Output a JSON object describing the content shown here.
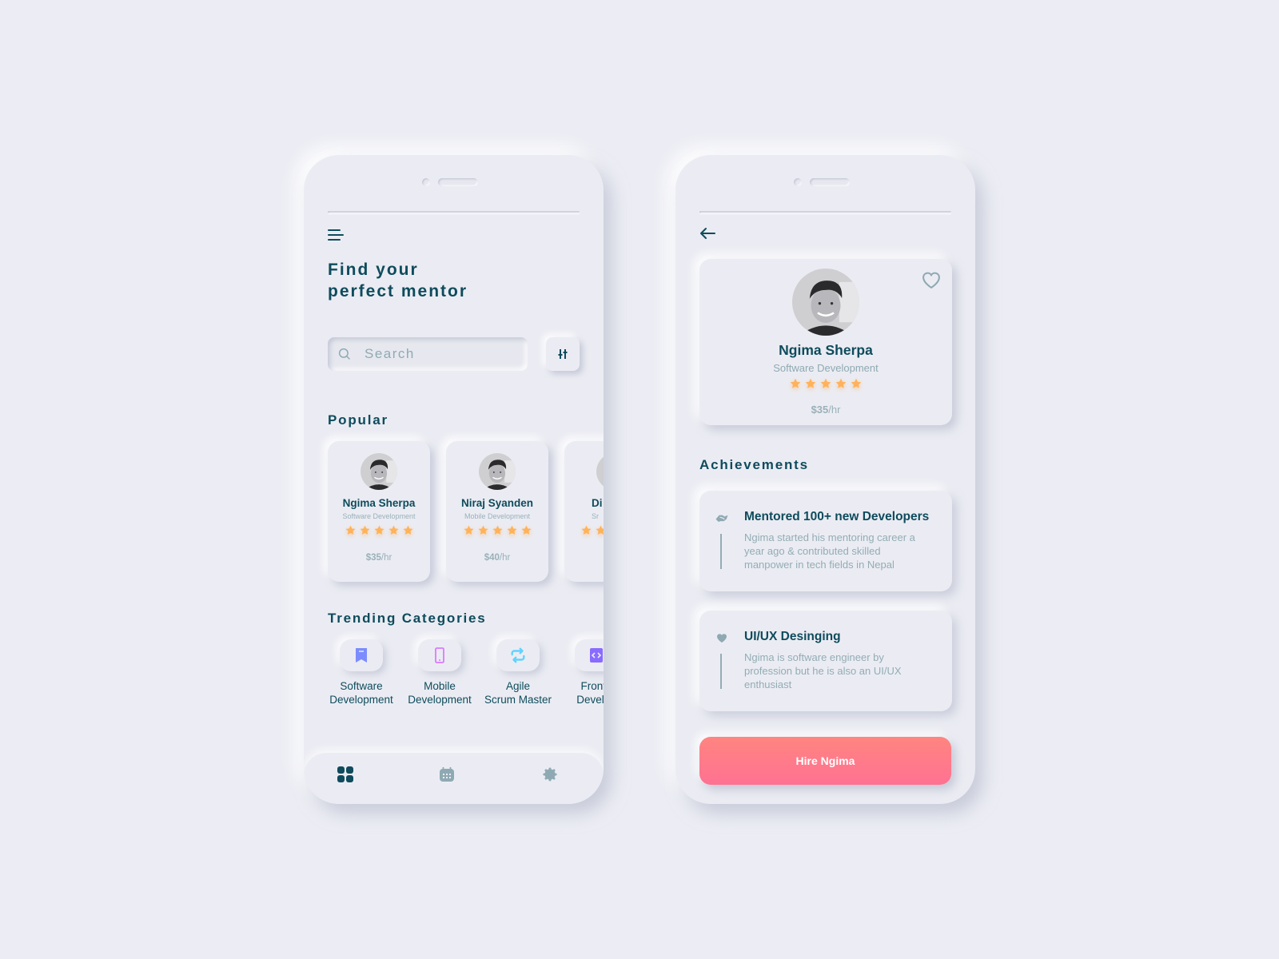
{
  "colors": {
    "background": "#ECEDF4",
    "primary_text": "#0E4B5C",
    "muted_text": "#93ACB4",
    "star": "#FFB25A",
    "hire_gradient_top": "#FF8580",
    "hire_gradient_bottom": "#FF7192"
  },
  "left_screen": {
    "menu_icon": "hamburger-menu-icon",
    "headline_line1": "Find your",
    "headline_line2": "perfect mentor",
    "search": {
      "placeholder": "Search",
      "value": "",
      "icon": "search-icon"
    },
    "filter_icon": "sliders-filter-icon",
    "popular_title": "Popular",
    "popular": [
      {
        "name": "Ngima Sherpa",
        "category": "Software Development",
        "rating": 5,
        "rate_amount": "$35",
        "rate_unit": "/hr"
      },
      {
        "name": "Niraj Syanden",
        "category": "Mobile Development",
        "rating": 5,
        "rate_amount": "$40",
        "rate_unit": "/hr"
      },
      {
        "name": "Di",
        "category": "Sr",
        "rating": 5,
        "rate_amount": "",
        "rate_unit": ""
      }
    ],
    "trending_title": "Trending Categories",
    "categories": [
      {
        "line1": "Software",
        "line2": "Development",
        "icon": "bookmark-icon",
        "color": "#7B8CFF"
      },
      {
        "line1": "Mobile",
        "line2": "Development",
        "icon": "smartphone-icon",
        "color": "#D77BFF"
      },
      {
        "line1": "Agile",
        "line2": "Scrum Master",
        "icon": "repeat-arrows-icon",
        "color": "#5FD3FF"
      },
      {
        "line1": "Fronte",
        "line2": "Develop",
        "icon": "code-icon",
        "color": "#8A6BFF"
      }
    ],
    "bottom_nav": [
      {
        "icon": "grid-dashboard-icon",
        "active": true
      },
      {
        "icon": "calendar-icon",
        "active": false
      },
      {
        "icon": "gear-icon",
        "active": false
      }
    ]
  },
  "right_screen": {
    "back_icon": "arrow-left-icon",
    "profile": {
      "name": "Ngima Sherpa",
      "category": "Software Development",
      "rating": 5,
      "rate_amount": "$35",
      "rate_unit": "/hr",
      "favorite_icon": "heart-outline-icon"
    },
    "achievements_title": "Achievements",
    "achievements": [
      {
        "icon": "handshake-icon",
        "title": "Mentored 100+ new Developers",
        "description": "Ngima started his mentoring career a year ago & contributed skilled manpower in tech fields in Nepal"
      },
      {
        "icon": "heart-icon",
        "title": "UI/UX Desinging",
        "description": "Ngima is software engineer by profession but he is also an UI/UX enthusiast"
      }
    ],
    "hire_button": "Hire Ngima"
  }
}
